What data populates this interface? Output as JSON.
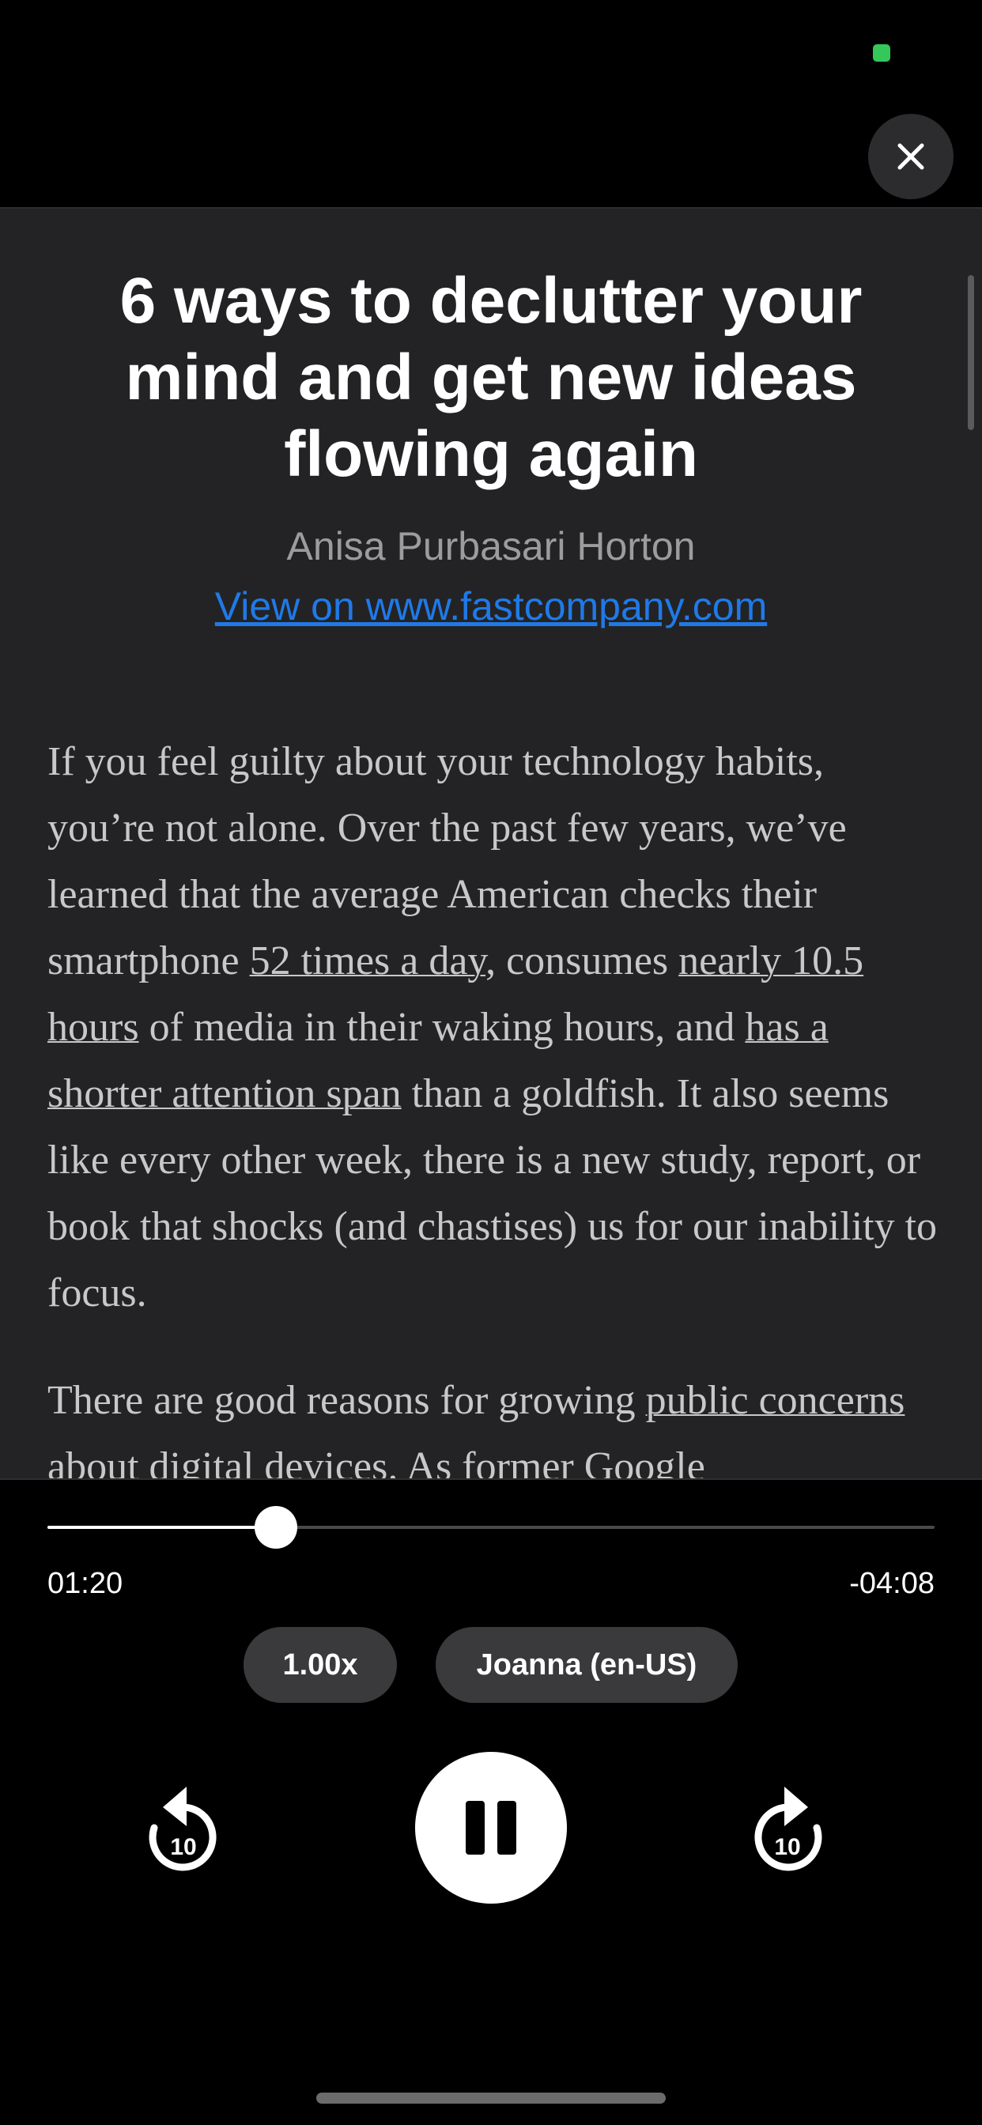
{
  "colors": {
    "background": "#000000",
    "article_background": "#232325",
    "link": "#1f7ae8",
    "status_dot": "#34c759"
  },
  "header": {
    "close_icon": "close-icon"
  },
  "article": {
    "title": "6 ways to declutter your mind and get new ideas flowing again",
    "author": "Anisa Purbasari Horton",
    "source_link": "View on www.fastcompany.com",
    "paragraph1": {
      "t1": "If you feel guilty about your technology habits, you’re not alone. Over the past few years, we’ve learned that the average American checks their smartphone ",
      "link1": "52 times a day",
      "t2": ", consumes ",
      "link2": "nearly 10.5 hours",
      "t3": " of media in their waking hours, and ",
      "link3": "has a shorter attention span",
      "t4": " than a goldfish. It also seems like every other week, there is a new study, report, or book that shocks (and chastises) us for our inability to focus."
    },
    "paragraph2": {
      "t1": "There are good reasons for growing ",
      "link1": "public concerns about digital devices",
      "t2": ". As former Google"
    }
  },
  "player": {
    "elapsed": "01:20",
    "remaining": "-04:08",
    "progress_fraction": 0.2574,
    "speed_label": "1.00x",
    "voice_label": "Joanna (en-US)",
    "skip_back_label": "10",
    "skip_forward_label": "10",
    "skip_back_icon": "rewind-10-icon",
    "skip_forward_icon": "forward-10-icon",
    "play_icon": "pause-icon"
  }
}
